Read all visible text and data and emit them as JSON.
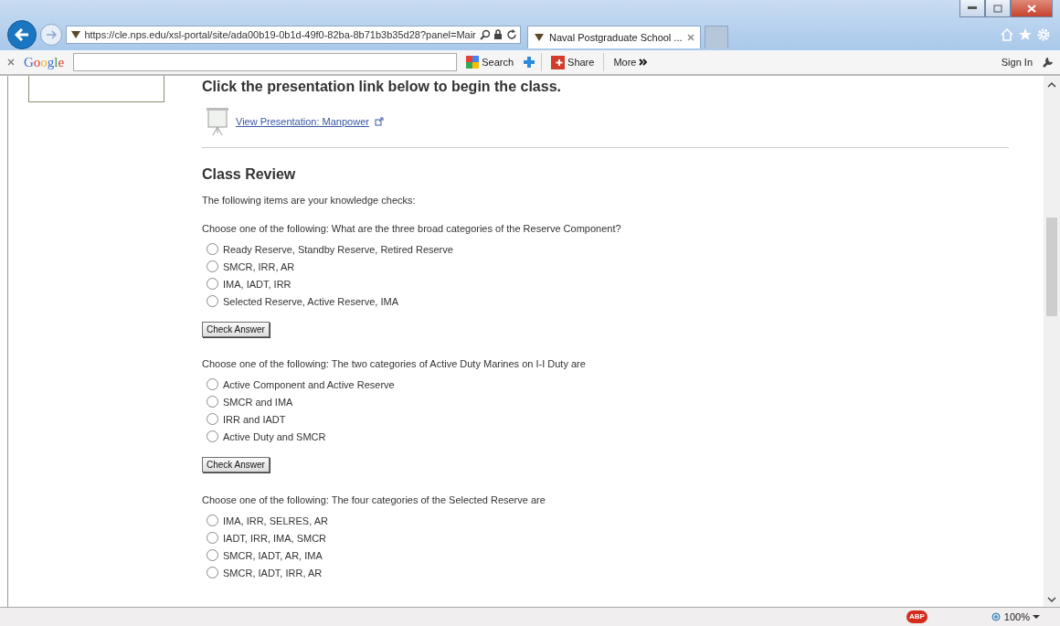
{
  "browser": {
    "address": "https://cle.nps.edu/xsl-portal/site/ada00b19-0b1d-49f0-82ba-8b71b3b35d28?panel=Mair",
    "tabs": [
      {
        "label": "Naval Postgraduate School ...",
        "selected": true
      }
    ],
    "google_toolbar": {
      "logo": "Google",
      "search": "Search",
      "share": "Share",
      "more": "More",
      "sign_in": "Sign In"
    },
    "status_bar": {
      "adblock": "ABP",
      "zoom": "100%"
    }
  },
  "page": {
    "intro_heading": "Click the presentation link below to begin the class.",
    "presentation_link": "View Presentation: Manpower",
    "review_heading": "Class Review",
    "review_intro": "The following items are your knowledge checks:",
    "questions": [
      {
        "prompt": "Choose one of the following: What are the three broad categories of the Reserve Component?",
        "button": "Check Answer",
        "options": [
          {
            "label": "Ready Reserve, Standby Reserve, Retired Reserve",
            "selected": false
          },
          {
            "label": "SMCR, IRR, AR",
            "selected": false
          },
          {
            "label": "IMA, IADT, IRR",
            "selected": false
          },
          {
            "label": "Selected Reserve, Active Reserve, IMA",
            "selected": false
          }
        ]
      },
      {
        "prompt": "Choose one of the following: The two categories of Active Duty Marines on I-I Duty are",
        "button": "Check Answer",
        "options": [
          {
            "label": "Active Component and Active Reserve",
            "selected": false
          },
          {
            "label": "SMCR and IMA",
            "selected": false
          },
          {
            "label": "IRR and IADT",
            "selected": false
          },
          {
            "label": "Active Duty and SMCR",
            "selected": false
          }
        ]
      },
      {
        "prompt": "Choose one of the following: The four categories of the Selected Reserve are",
        "options": [
          {
            "label": "IMA, IRR, SELRES, AR",
            "selected": false
          },
          {
            "label": "IADT, IRR, IMA, SMCR",
            "selected": false
          },
          {
            "label": "SMCR, IADT, AR, IMA",
            "selected": false
          },
          {
            "label": "SMCR, IADT, IRR, AR",
            "selected": false
          }
        ]
      }
    ]
  }
}
